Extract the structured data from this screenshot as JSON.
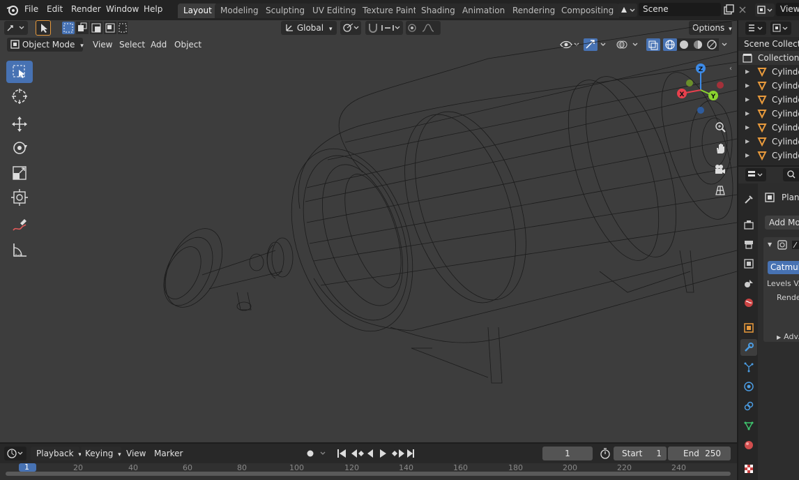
{
  "menus": [
    "File",
    "Edit",
    "Render",
    "Window",
    "Help"
  ],
  "workspaces": [
    {
      "label": "Layout",
      "active": true
    },
    {
      "label": "Modeling",
      "active": false
    },
    {
      "label": "Sculpting",
      "active": false
    },
    {
      "label": "UV Editing",
      "active": false
    },
    {
      "label": "Texture Paint",
      "active": false
    },
    {
      "label": "Shading",
      "active": false
    },
    {
      "label": "Animation",
      "active": false
    },
    {
      "label": "Rendering",
      "active": false
    },
    {
      "label": "Compositing",
      "active": false
    }
  ],
  "scene": {
    "name": "Scene",
    "view_layer": "View"
  },
  "tool_header": {
    "orientation": "Global",
    "options": "Options"
  },
  "viewport_header": {
    "mode": "Object Mode",
    "view": "View",
    "select": "Select",
    "add": "Add",
    "object": "Object"
  },
  "gizmo": {
    "x": "X",
    "y": "Y",
    "z": "Z"
  },
  "timeline": {
    "playback": "Playback",
    "keying": "Keying",
    "view": "View",
    "marker": "Marker",
    "current_frame": "1",
    "start_label": "Start",
    "start_value": "1",
    "end_label": "End",
    "end_value": "250",
    "ruler": [
      "1",
      "20",
      "40",
      "60",
      "80",
      "100",
      "120",
      "140",
      "160",
      "180",
      "200",
      "220",
      "240"
    ]
  },
  "outliner": {
    "header": "Scene Collection",
    "collection": "Collection",
    "items": [
      "Cylinder",
      "Cylinder",
      "Cylinder",
      "Cylinder",
      "Cylinder",
      "Cylinder",
      "Cylinder"
    ]
  },
  "properties": {
    "object_name": "Plane",
    "add_modifier": "Add Modifier",
    "subdiv_type": "Catmull-Clark",
    "levels_viewport": "Levels V...",
    "render": "Render",
    "advanced": "Adv..."
  },
  "colors": {
    "accent": "#4772b3",
    "axis_x": "#e8404d",
    "axis_y": "#8bd42f",
    "axis_z": "#3d8be8",
    "object_icon": "#e89a3c"
  }
}
